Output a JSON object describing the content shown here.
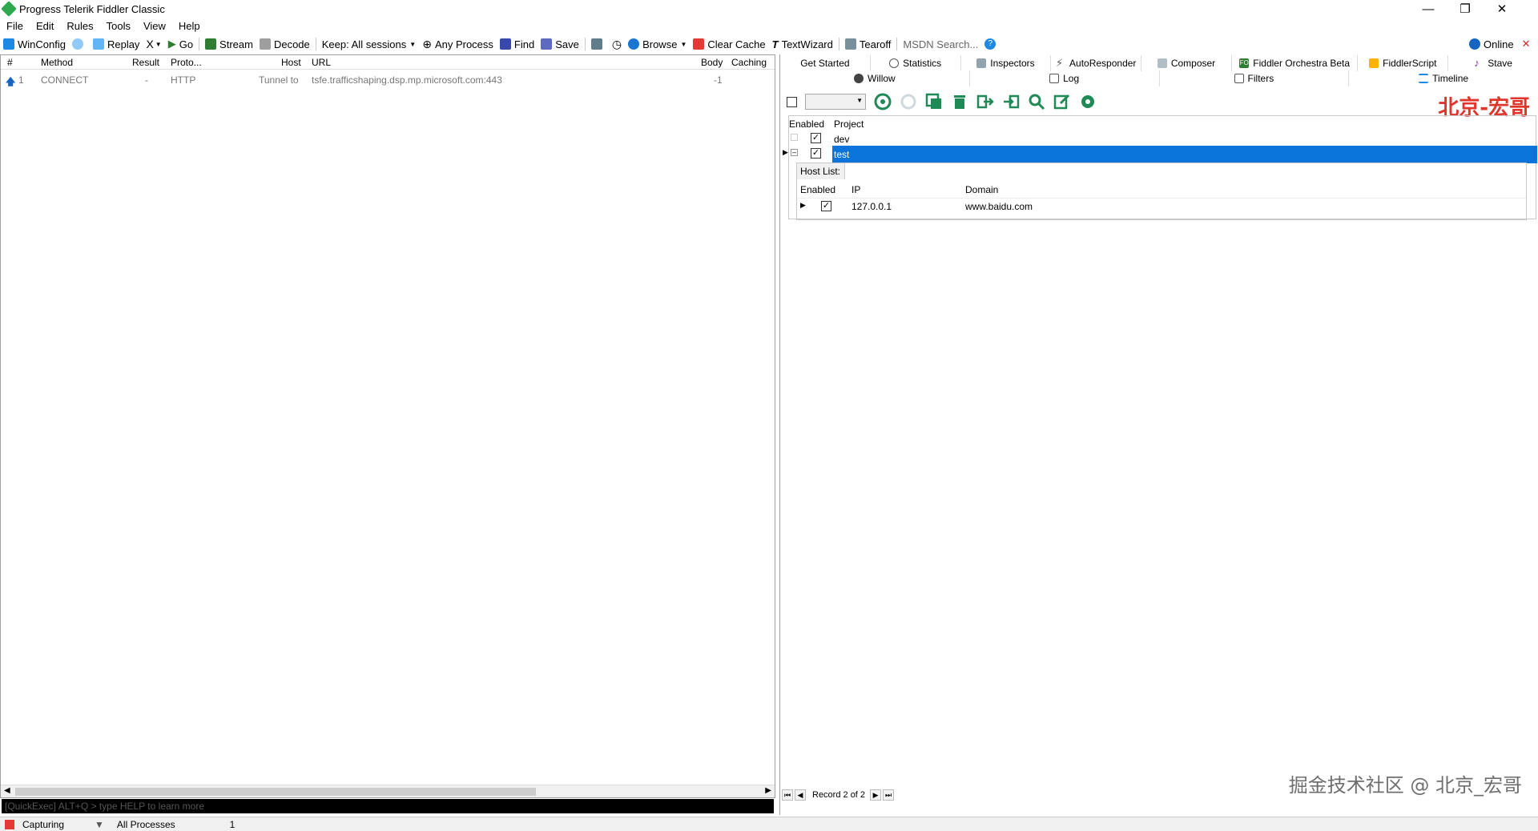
{
  "window": {
    "title": "Progress Telerik Fiddler Classic"
  },
  "menu": [
    "File",
    "Edit",
    "Rules",
    "Tools",
    "View",
    "Help"
  ],
  "toolbar": {
    "winconfig": "WinConfig",
    "replay": "Replay",
    "remove": "X",
    "go": "Go",
    "stream": "Stream",
    "decode": "Decode",
    "keep": "Keep: All sessions",
    "any_process": "Any Process",
    "find": "Find",
    "save": "Save",
    "browse": "Browse",
    "clear_cache": "Clear Cache",
    "textwizard": "TextWizard",
    "tearoff": "Tearoff",
    "msdn": "MSDN Search...",
    "online": "Online"
  },
  "sessions": {
    "columns": [
      "#",
      "Method",
      "Result",
      "Proto...",
      "Host",
      "URL",
      "Body",
      "Caching"
    ],
    "rows": [
      {
        "num": "1",
        "method": "CONNECT",
        "result": "-",
        "proto": "HTTP",
        "host": "Tunnel to",
        "url": "tsfe.trafficshaping.dsp.mp.microsoft.com:443",
        "body": "-1",
        "caching": ""
      }
    ]
  },
  "quickexec": "[QuickExec] ALT+Q > type HELP to learn more",
  "status": {
    "capturing": "Capturing",
    "processes": "All Processes",
    "count": "1"
  },
  "tabs_row1": [
    "Get Started",
    "Statistics",
    "Inspectors",
    "AutoResponder",
    "Composer",
    "Fiddler Orchestra Beta",
    "FiddlerScript",
    "Stave"
  ],
  "tabs_row2": [
    "Willow",
    "Log",
    "Filters",
    "Timeline"
  ],
  "willow": {
    "watermark": "北京-宏哥",
    "columns": {
      "enabled": "Enabled",
      "project": "Project"
    },
    "projects": [
      {
        "name": "dev",
        "enabled": true
      },
      {
        "name": "test",
        "enabled": true
      }
    ],
    "hostlist": {
      "title": "Host List:",
      "columns": {
        "enabled": "Enabled",
        "ip": "IP",
        "domain": "Domain"
      },
      "rows": [
        {
          "ip": "127.0.0.1",
          "domain": "www.baidu.com",
          "enabled": true
        }
      ]
    },
    "record": "Record 2 of 2",
    "footer_watermark": "掘金技术社区 @ 北京_宏哥"
  },
  "colors": {
    "selection": "#0a74da",
    "watermark_red": "#e0352b",
    "willow_green": "#1f8a55"
  }
}
